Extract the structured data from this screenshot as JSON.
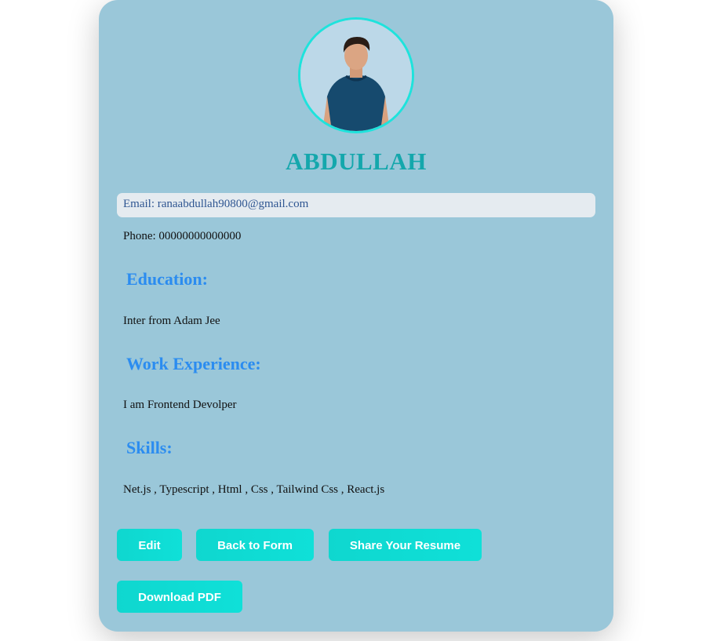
{
  "profile": {
    "name": "ABDULLAH",
    "email_line": "Email: ranaabdullah90800@gmail.com",
    "phone_line": "Phone: 00000000000000"
  },
  "sections": {
    "education": {
      "heading": "Education:",
      "text": "Inter from Adam Jee"
    },
    "work": {
      "heading": "Work Experience:",
      "text": "I am Frontend Devolper"
    },
    "skills": {
      "heading": "Skills:",
      "text": "Net.js , Typescript , Html , Css , Tailwind Css , React.js"
    }
  },
  "buttons": {
    "edit": "Edit",
    "back": "Back to Form",
    "share": "Share Your Resume",
    "download": "Download PDF"
  },
  "colors": {
    "card_bg": "#9ac7d9",
    "accent": "#14a7ac",
    "heading": "#2b8cf0",
    "button": "#0fd7cf",
    "avatar_ring": "#1ee3dc"
  }
}
